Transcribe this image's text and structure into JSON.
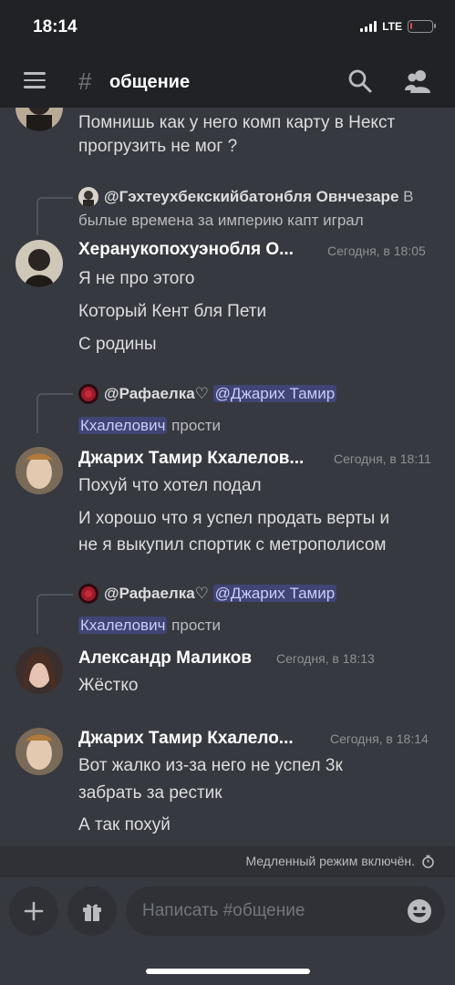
{
  "status_bar": {
    "time": "18:14",
    "network": "LTE",
    "battery_level": 0.1
  },
  "header": {
    "hash": "#",
    "channel_name": "общение"
  },
  "messages": {
    "m0": {
      "lines": [
        "Помнишь как у него комп карту в Некст",
        "прогрузить не мог ?"
      ]
    },
    "m1": {
      "reply_user": "@Гэхтеухбекскийбатонбля Овнчезаре",
      "reply_text_1": " В",
      "reply_text_2": "былые времена за империю капт играл",
      "username": "Херанукопохуэнобля О...",
      "timestamp": "Сегодня, в 18:05",
      "lines": [
        "Я не про этого",
        "Который Кент бля Пети",
        "С родины"
      ]
    },
    "m2": {
      "reply_user": "@Рафаелка♡",
      "reply_mention_1": "@Джарих Тамир",
      "reply_mention_2": "Кхалелович",
      "reply_text": " прости",
      "username": "Джарих Тамир Кхалелов...",
      "timestamp": "Сегодня, в 18:11",
      "lines": [
        "Похуй что хотел подал",
        "И хорошо что я успел продать верты и",
        "не я выкупил спортик с метрополисом"
      ]
    },
    "m3": {
      "reply_user": "@Рафаелка♡",
      "reply_mention_1": "@Джарих Тамир",
      "reply_mention_2": "Кхалелович",
      "reply_text": " прости",
      "username": "Александр Маликов",
      "timestamp": "Сегодня, в 18:13",
      "lines": [
        "Жёстко"
      ]
    },
    "m4": {
      "username": "Джарих Тамир Кхалело...",
      "timestamp": "Сегодня, в 18:14",
      "lines": [
        "Вот жалко из-за него не успел 3к",
        "забрать за рестик",
        "А так похуй"
      ]
    }
  },
  "slowmode": {
    "text": "Медленный режим включён."
  },
  "composer": {
    "placeholder": "Написать #общение"
  },
  "colors": {
    "background": "#36393f",
    "header": "#202225",
    "mention_bg": "#4e5487",
    "battery_low": "#ed4245"
  },
  "icons": [
    "menu-icon",
    "search-icon",
    "members-icon",
    "plus-icon",
    "gift-icon",
    "emoji-icon",
    "timer-icon"
  ]
}
